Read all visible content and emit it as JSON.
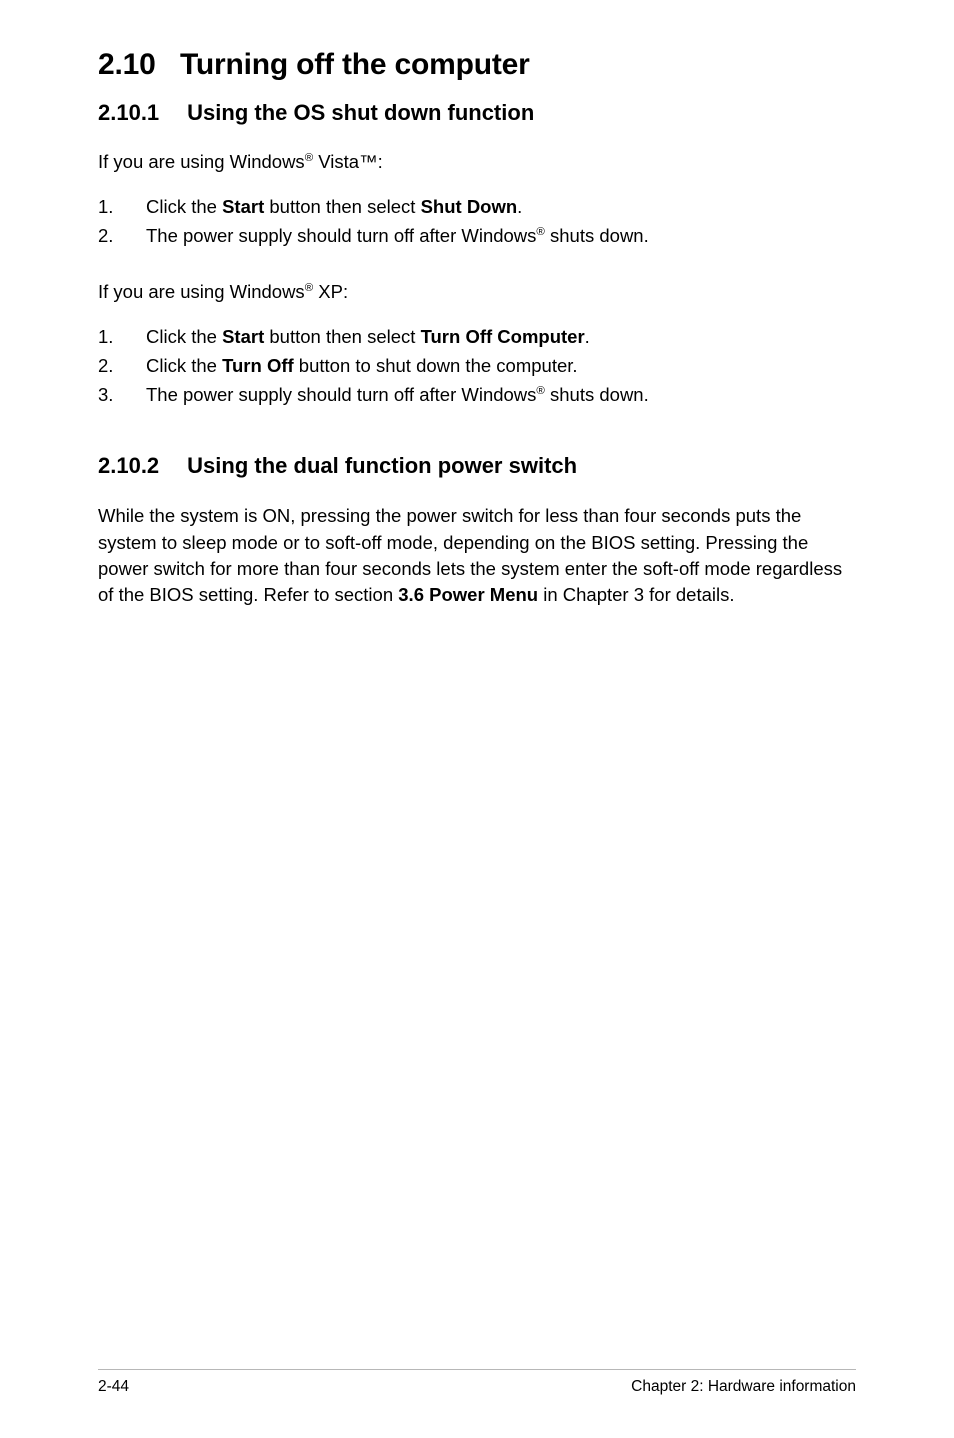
{
  "section": {
    "number": "2.10",
    "title": "Turning off the computer"
  },
  "sub1": {
    "number": "2.10.1",
    "title": "Using the OS shut down function",
    "vista_intro_before": "If you are using Windows",
    "vista_intro_after": " Vista™:",
    "vista_steps": [
      {
        "pre": "Click the ",
        "bold1": "Start",
        "mid": " button then select ",
        "bold2": "Shut Down",
        "post": "."
      },
      {
        "pre": "The power supply should turn off after Windows",
        "sup": "®",
        "post": " shuts down."
      }
    ],
    "xp_intro_before": "If you are using Windows",
    "xp_intro_after": " XP:",
    "xp_steps": [
      {
        "pre": "Click the ",
        "bold1": "Start",
        "mid": " button then select ",
        "bold2": "Turn Off Computer",
        "post": "."
      },
      {
        "pre": "Click the ",
        "bold1": "Turn Off",
        "post": " button to shut down the computer."
      },
      {
        "pre": "The power supply should turn off after Windows",
        "sup": "®",
        "post": " shuts down."
      }
    ]
  },
  "sub2": {
    "number": "2.10.2",
    "title": "Using the dual function power switch",
    "para_before": "While the system is ON, pressing the power switch for less than four seconds puts the system to sleep mode or to soft-off mode, depending on the BIOS setting. Pressing the power switch for more than four seconds lets the system enter the soft-off mode regardless of the BIOS setting. Refer to section ",
    "para_bold": "3.6 Power Menu",
    "para_after": " in Chapter 3 for details."
  },
  "footer": {
    "page": "2-44",
    "chapter": "Chapter 2: Hardware information"
  },
  "glyphs": {
    "reg": "®"
  }
}
